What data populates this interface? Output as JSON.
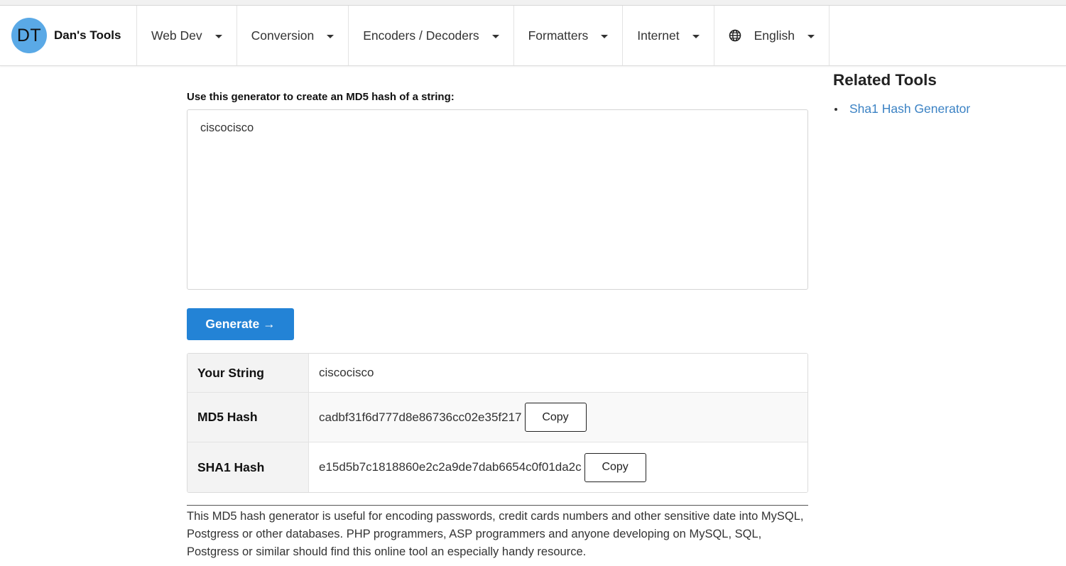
{
  "brand": {
    "logo": "DT",
    "name": "Dan's Tools"
  },
  "nav": {
    "items": [
      {
        "label": "Web Dev"
      },
      {
        "label": "Conversion"
      },
      {
        "label": "Encoders / Decoders"
      },
      {
        "label": "Formatters"
      },
      {
        "label": "Internet"
      }
    ],
    "language": {
      "label": "English",
      "icon": "globe-icon"
    }
  },
  "main": {
    "intro": "Use this generator to create an MD5 hash of a string:",
    "input_value": "ciscocisco",
    "generate_label": "Generate →",
    "results": [
      {
        "label": "Your String",
        "value": "ciscocisco"
      },
      {
        "label": "MD5 Hash",
        "value": "cadbf31f6d777d8e86736cc02e35f217",
        "copy_label": "Copy"
      },
      {
        "label": "SHA1 Hash",
        "value": "e15d5b7c1818860e2c2a9de7dab6654c0f01da2c",
        "copy_label": "Copy"
      }
    ],
    "description": "This MD5 hash generator is useful for encoding passwords, credit cards numbers and other sensitive date into MySQL, Postgress or other databases. PHP programmers, ASP programmers and anyone developing on MySQL, SQL, Postgress or similar should find this online tool an especially handy resource."
  },
  "sidebar": {
    "title": "Related Tools",
    "links": [
      {
        "label": "Sha1 Hash Generator"
      }
    ]
  },
  "colors": {
    "accent": "#2383d6",
    "logo": "#5aa9e6",
    "link": "#3b82c4"
  }
}
